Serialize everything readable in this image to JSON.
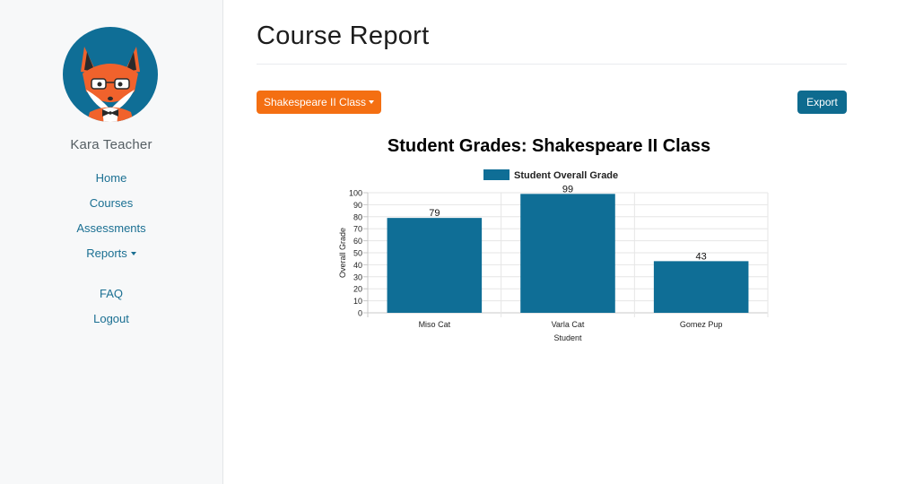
{
  "sidebar": {
    "user_name": "Kara Teacher",
    "nav": [
      {
        "label": "Home"
      },
      {
        "label": "Courses"
      },
      {
        "label": "Assessments"
      },
      {
        "label": "Reports"
      },
      {
        "label": "FAQ"
      },
      {
        "label": "Logout"
      }
    ]
  },
  "main": {
    "title": "Course Report",
    "class_select_label": "Shakespeare II Class",
    "export_label": "Export"
  },
  "colors": {
    "accent_orange": "#f46f12",
    "accent_teal": "#0e6b8f",
    "bar": "#0f6e96"
  },
  "chart_data": {
    "type": "bar",
    "title": "Student Grades: Shakespeare II Class",
    "categories": [
      "Miso Cat",
      "Varla Cat",
      "Gomez Pup"
    ],
    "series": [
      {
        "name": "Student Overall Grade",
        "values": [
          79,
          99,
          43
        ]
      }
    ],
    "xlabel": "Student",
    "ylabel": "Overall Grade",
    "ylim": [
      0,
      100
    ],
    "yticks": [
      0,
      10,
      20,
      30,
      40,
      50,
      60,
      70,
      80,
      90,
      100
    ],
    "grid": true,
    "legend": "top-center",
    "data_labels": true
  }
}
